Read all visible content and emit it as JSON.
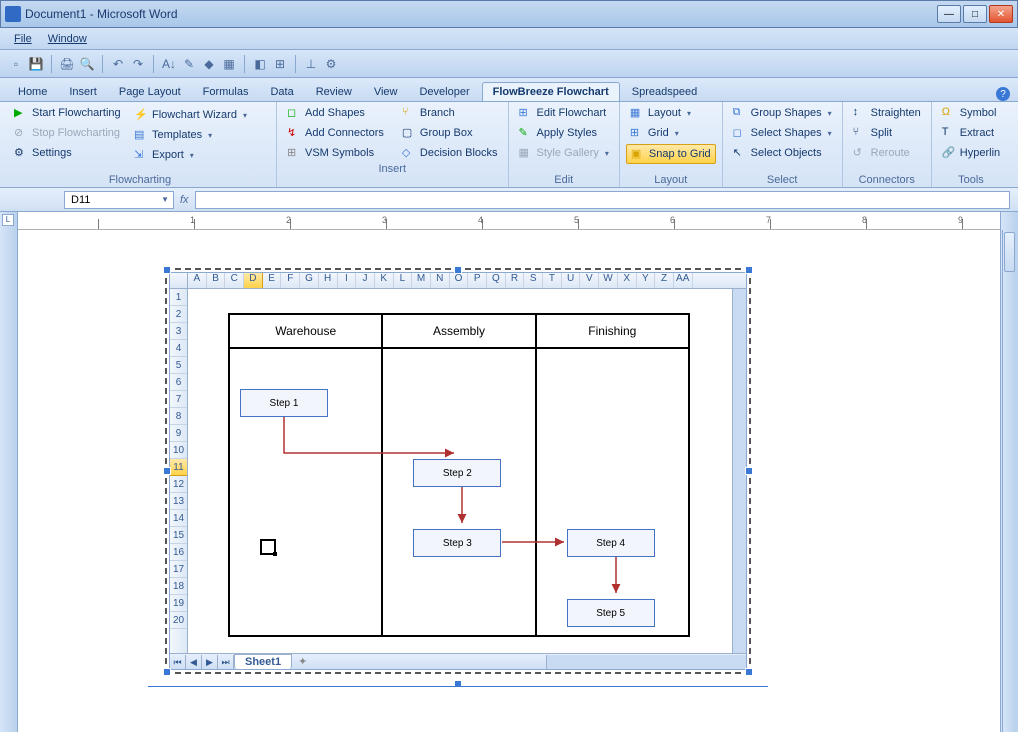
{
  "window": {
    "title": "Document1 - Microsoft Word"
  },
  "menus": {
    "file": "File",
    "window": "Window"
  },
  "tabs": [
    "Home",
    "Insert",
    "Page Layout",
    "Formulas",
    "Data",
    "Review",
    "View",
    "Developer",
    "FlowBreeze Flowchart",
    "Spreadspeed"
  ],
  "active_tab": "FlowBreeze Flowchart",
  "ribbon": {
    "flowcharting": {
      "label": "Flowcharting",
      "start": "Start Flowcharting",
      "stop": "Stop Flowcharting",
      "settings": "Settings",
      "wizard": "Flowchart Wizard",
      "templates": "Templates",
      "export": "Export"
    },
    "insert": {
      "label": "Insert",
      "add_shapes": "Add Shapes",
      "add_connectors": "Add Connectors",
      "vsm": "VSM Symbols",
      "branch": "Branch",
      "groupbox": "Group Box",
      "decision": "Decision Blocks"
    },
    "edit": {
      "label": "Edit",
      "edit_flow": "Edit Flowchart",
      "apply_styles": "Apply Styles",
      "style_gallery": "Style Gallery"
    },
    "layout": {
      "label": "Layout",
      "layout": "Layout",
      "grid": "Grid",
      "snap": "Snap to Grid"
    },
    "select": {
      "label": "Select",
      "group_shapes": "Group Shapes",
      "select_shapes": "Select Shapes",
      "select_objects": "Select Objects"
    },
    "connectors": {
      "label": "Connectors",
      "straighten": "Straighten",
      "split": "Split",
      "reroute": "Reroute"
    },
    "tools": {
      "label": "Tools",
      "symbol": "Symbol",
      "extract": "Extract",
      "hyperlink": "Hyperlin"
    }
  },
  "namebox": "D11",
  "fx_label": "fx",
  "columns": [
    "A",
    "B",
    "C",
    "D",
    "E",
    "F",
    "G",
    "H",
    "I",
    "J",
    "K",
    "L",
    "M",
    "N",
    "O",
    "P",
    "Q",
    "R",
    "S",
    "T",
    "U",
    "V",
    "W",
    "X",
    "Y",
    "Z",
    "AA"
  ],
  "selected_col": "D",
  "row_count": 20,
  "selected_row": 11,
  "sheet_tab": "Sheet1",
  "swimlanes": [
    "Warehouse",
    "Assembly",
    "Finishing"
  ],
  "steps": {
    "s1": "Step 1",
    "s2": "Step 2",
    "s3": "Step 3",
    "s4": "Step 4",
    "s5": "Step 5"
  }
}
